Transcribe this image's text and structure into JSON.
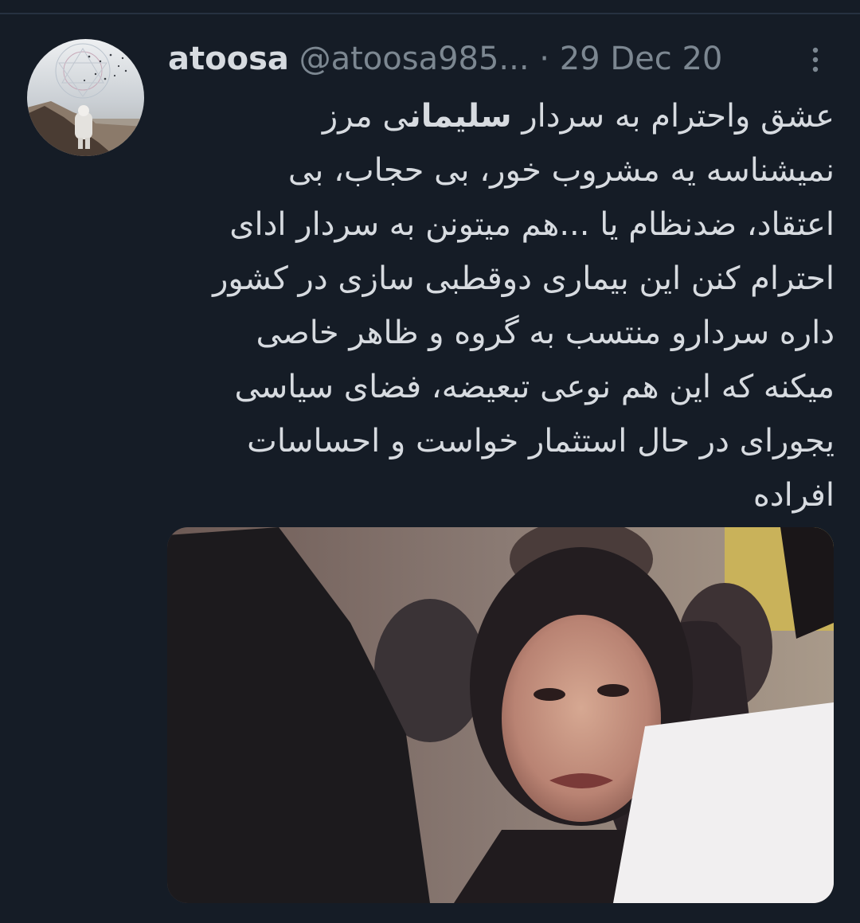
{
  "tweet": {
    "display_name": "atoosa",
    "handle": "@atoosa985...",
    "separator": "·",
    "date": "29 Dec 20",
    "lines": [
      {
        "before": "عشق واحترام به سردار ",
        "bold": "سلیمان",
        "after": "ی مرز"
      },
      {
        "before": "نمیشناسه یه مشروب خور، بی حجاب، بی",
        "bold": "",
        "after": ""
      },
      {
        "before": "اعتقاد، ضدنظام یا ...هم میتونن به سردار ادای",
        "bold": "",
        "after": ""
      },
      {
        "before": "احترام کنن این بیماری دوقطبی سازی در کشور",
        "bold": "",
        "after": ""
      },
      {
        "before": "داره سردارو منتسب به گروه و ظاهر خاصی",
        "bold": "",
        "after": ""
      },
      {
        "before": "میکنه که این هم نوعی تبعیضه، فضای سیاسی",
        "bold": "",
        "after": ""
      },
      {
        "before": "یجورای در حال استثمار خواست و احساسات",
        "bold": "",
        "after": ""
      },
      {
        "before": "افراده",
        "bold": "",
        "after": ""
      }
    ]
  },
  "icons": {
    "more": "more-vertical-icon"
  },
  "colors": {
    "background": "#151c26",
    "text": "#d7dbe0",
    "muted": "#7c8791",
    "divider": "#263140"
  }
}
